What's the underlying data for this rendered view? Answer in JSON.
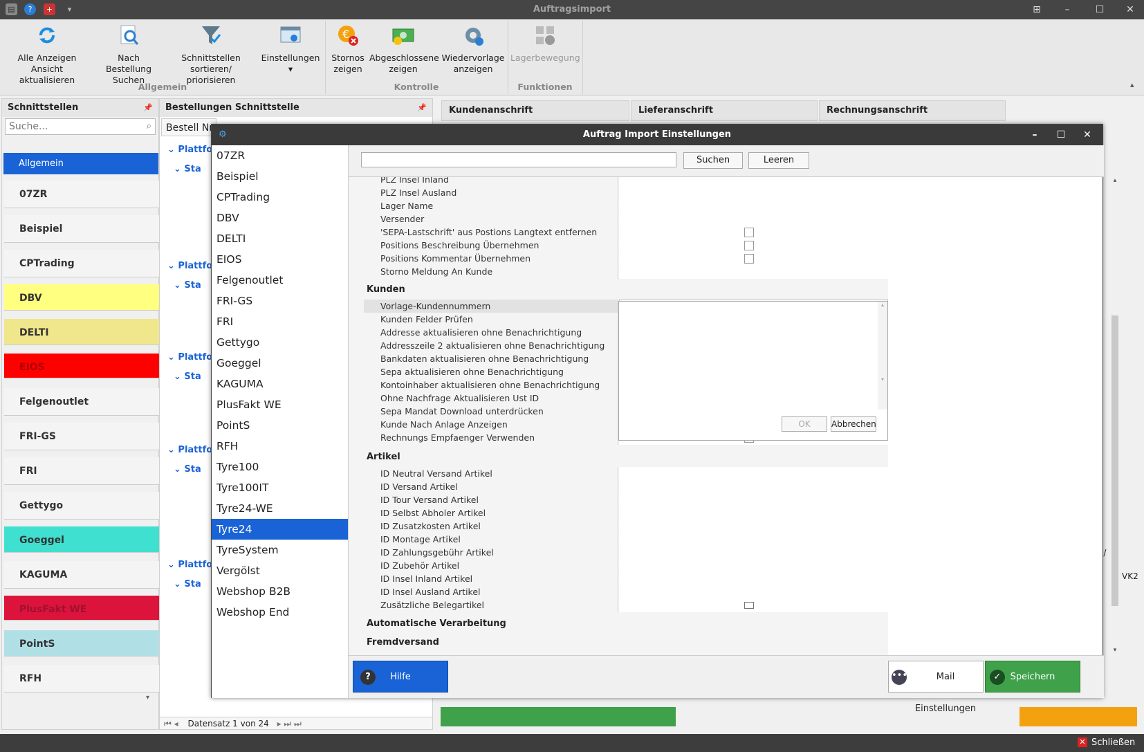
{
  "app": {
    "title": "Auftragsimport"
  },
  "ribbon": {
    "buttons": [
      {
        "label1": "Alle Anzeigen",
        "label2": "Ansicht aktualisieren"
      },
      {
        "label1": "Nach Bestellung",
        "label2": "Suchen"
      },
      {
        "label1": "Schnittstellen",
        "label2": "sortieren/ priorisieren"
      },
      {
        "label1": "Einstellungen",
        "label2": "▾"
      },
      {
        "label1": "Stornos",
        "label2": "zeigen"
      },
      {
        "label1": "Abgeschlossene",
        "label2": "zeigen"
      },
      {
        "label1": "Wiedervorlage",
        "label2": "anzeigen"
      },
      {
        "label1": "Lagerbewegung",
        "label2": ""
      }
    ],
    "groups": [
      "Allgemein",
      "Kontrolle",
      "Funktionen"
    ]
  },
  "left_panel": {
    "title": "Schnittstellen",
    "search_placeholder": "Suche...",
    "items": [
      {
        "label": "Allgemein",
        "color": "#1a63d6"
      },
      {
        "label": "07ZR",
        "color": "#f4f4f4"
      },
      {
        "label": "Beispiel",
        "color": "#f4f4f4"
      },
      {
        "label": "CPTrading",
        "color": "#f4f4f4"
      },
      {
        "label": "DBV",
        "color": "#ffff80"
      },
      {
        "label": "DELTI",
        "color": "#f0e68c"
      },
      {
        "label": "EIOS",
        "color": "#ff0000"
      },
      {
        "label": "Felgenoutlet",
        "color": "#f4f4f4"
      },
      {
        "label": "FRI-GS",
        "color": "#f4f4f4"
      },
      {
        "label": "FRI",
        "color": "#f4f4f4"
      },
      {
        "label": "Gettygo",
        "color": "#f4f4f4"
      },
      {
        "label": "Goeggel",
        "color": "#40e0d0"
      },
      {
        "label": "KAGUMA",
        "color": "#f4f4f4"
      },
      {
        "label": "PlusFakt WE",
        "color": "#dc143c"
      },
      {
        "label": "PointS",
        "color": "#b0e0e6"
      },
      {
        "label": "RFH",
        "color": "#f4f4f4"
      }
    ]
  },
  "mid_panel": {
    "title": "Bestellungen Schnittstelle",
    "column": "Bestell Nr",
    "group_label": "Plattfo",
    "sub_label": "Sta",
    "nav_text": "Datensatz 1 von 24"
  },
  "right_panel": {
    "headers": [
      "Kundenanschrift",
      "Lieferanschrift",
      "Rechnungsanschrift"
    ],
    "col_vk2": "VK2",
    "col_partial": "l/ I"
  },
  "dialog": {
    "title": "Auftrag Import Einstellungen",
    "search_button": "Suchen",
    "clear_button": "Leeren",
    "interfaces": [
      "07ZR",
      "Beispiel",
      "CPTrading",
      "DBV",
      "DELTI",
      "EIOS",
      "Felgenoutlet",
      "FRI-GS",
      "FRI",
      "Gettygo",
      "Goeggel",
      "KAGUMA",
      "PlusFakt WE",
      "PointS",
      "RFH",
      "Tyre100",
      "Tyre100IT",
      "Tyre24-WE",
      "Tyre24",
      "TyreSystem",
      "Vergölst",
      "Webshop B2B",
      "Webshop End"
    ],
    "selected_interface": "Tyre24",
    "rows_top": [
      {
        "label": "PLZ Insel Inland",
        "check": ""
      },
      {
        "label": "PLZ Insel Ausland",
        "check": ""
      },
      {
        "label": "Lager Name",
        "check": ""
      },
      {
        "label": "Versender",
        "check": ""
      },
      {
        "label": "'SEPA-Lastschrift' aus Postions Langtext entfernen",
        "check": "box"
      },
      {
        "label": "Positions Beschreibung Übernehmen",
        "check": "box"
      },
      {
        "label": "Positions Kommentar Übernehmen",
        "check": "box"
      },
      {
        "label": "Storno Meldung An Kunde",
        "check": ""
      }
    ],
    "cat_kunden": "Kunden",
    "rows_kunden": [
      {
        "label": "Vorlage-Kundennummern"
      },
      {
        "label": "Kunden Felder Prüfen"
      },
      {
        "label": "Addresse aktualisieren ohne Benachrichtigung"
      },
      {
        "label": "Addresszeile 2 aktualisieren ohne Benachrichtigung"
      },
      {
        "label": "Bankdaten aktualisieren ohne Benachrichtigung"
      },
      {
        "label": "Sepa aktualisieren ohne Benachrichtigung"
      },
      {
        "label": "Kontoinhaber aktualisieren ohne Benachrichtigung"
      },
      {
        "label": "Ohne Nachfrage Aktualisieren Ust ID"
      },
      {
        "label": "Sepa Mandat Download unterdrücken"
      },
      {
        "label": "Kunde Nach Anlage Anzeigen"
      },
      {
        "label": "Rechnungs Empfaenger Verwenden"
      }
    ],
    "popup": {
      "ok": "OK",
      "cancel": "Abbrechen",
      "glyph": "A"
    },
    "cat_artikel": "Artikel",
    "rows_artikel": [
      {
        "label": "ID Neutral Versand Artikel"
      },
      {
        "label": "ID Versand Artikel"
      },
      {
        "label": "ID Tour Versand Artikel"
      },
      {
        "label": "ID Selbst Abholer Artikel"
      },
      {
        "label": "ID Zusatzkosten Artikel"
      },
      {
        "label": "ID Montage Artikel"
      },
      {
        "label": "ID Zahlungsgebühr Artikel"
      },
      {
        "label": "ID Zubehör Artikel"
      },
      {
        "label": "ID Insel Inland Artikel"
      },
      {
        "label": "ID Insel Ausland Artikel"
      },
      {
        "label": "Zusätzliche Belegartikel"
      }
    ],
    "cat_auto": "Automatische Verarbeitung",
    "cat_fremd": "Fremdversand",
    "help_button": "Hilfe",
    "mail_button": "Mail Einstellungen",
    "save_button": "Speichern"
  },
  "status": {
    "close_label": "Schließen"
  }
}
